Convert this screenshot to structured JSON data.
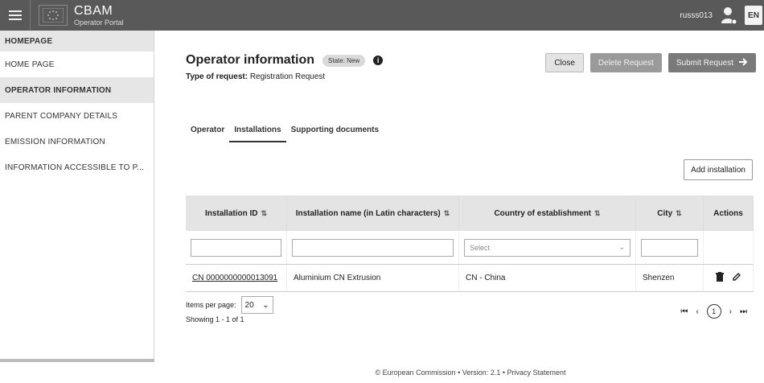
{
  "header": {
    "brand_title": "CBAM",
    "brand_subtitle": "Operator Portal",
    "username": "russs013",
    "language": "EN",
    "colors": {
      "topbar": "#595959"
    }
  },
  "sidebar": {
    "items": [
      {
        "label": "HOMEPAGE"
      },
      {
        "label": "HOME PAGE"
      },
      {
        "label": "OPERATOR INFORMATION"
      },
      {
        "label": "PARENT COMPANY DETAILS"
      },
      {
        "label": "EMISSION INFORMATION"
      },
      {
        "label": "INFORMATION ACCESSIBLE TO P..."
      }
    ]
  },
  "main": {
    "title": "Operator information",
    "status_badge": "State: New",
    "request_type_label": "Type of request:",
    "request_type_value": "Registration Request",
    "actions": {
      "close": "Close",
      "delete": "Delete Request",
      "submit": "Submit Request"
    },
    "tabs": [
      {
        "label": "Operator"
      },
      {
        "label": "Installations"
      },
      {
        "label": "Supporting documents"
      }
    ],
    "add_button": "Add installation",
    "table": {
      "headers": [
        "Installation ID",
        "Installation name (in Latin characters)",
        "Country of establishment",
        "City",
        "Actions"
      ],
      "filter_select_placeholder": "Select",
      "rows": [
        {
          "id": "CN 0000000000013091",
          "name": "Aluminium CN Extrusion",
          "country": "CN - China",
          "city": "Shenzen"
        }
      ]
    },
    "pagination": {
      "items_per_page_label": "Items per page:",
      "items_per_page": "20",
      "showing": "Showing 1 - 1 of 1",
      "current_page": "1"
    }
  },
  "footer": {
    "text": "© European Commission  •  Version: 2.1  •  Privacy Statement"
  }
}
